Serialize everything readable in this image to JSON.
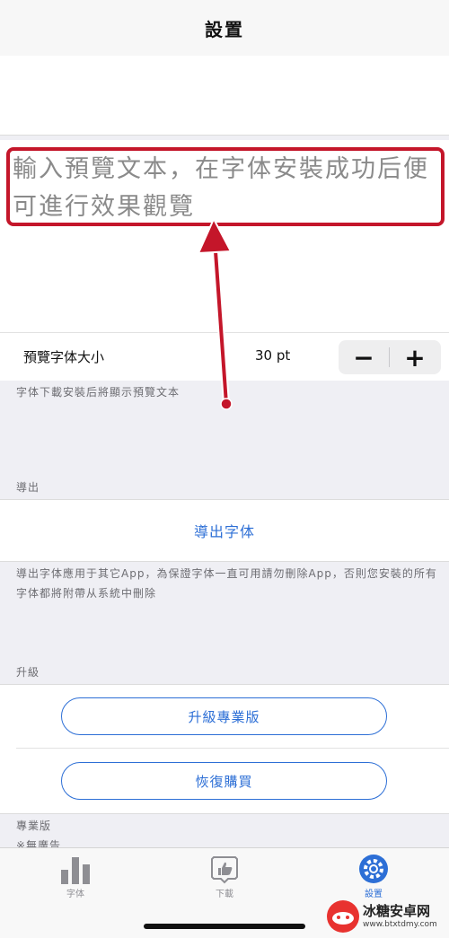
{
  "nav": {
    "title": "設置"
  },
  "preview": {
    "text": "輸入預覽文本，在字体安裝成功后便可進行效果觀覽"
  },
  "font_size": {
    "label": "預覽字体大小",
    "value": "30 pt",
    "minus": "−",
    "plus": "+"
  },
  "notes": {
    "preview_note": "字体下載安裝后將顯示預覽文本",
    "export_header": "導出",
    "export_note": "導出字体應用于其它App，為保證字体一直可用請勿刪除App，否則您安裝的所有字体都將附帶从系統中刪除",
    "upgrade_header": "升級",
    "pro_header": "專業版",
    "pro_item": "※無廣告"
  },
  "export": {
    "button_label": "導出字体"
  },
  "upgrade": {
    "upgrade_label": "升級專業版",
    "restore_label": "恢復購買"
  },
  "tabs": [
    {
      "label": "字体",
      "icon": "bar-chart-icon"
    },
    {
      "label": "下載",
      "icon": "thumbs-up-icon"
    },
    {
      "label": "設置",
      "icon": "gear-icon"
    }
  ],
  "watermark": {
    "title": "冰糖安卓网",
    "url": "www.btxtdmy.com"
  },
  "colors": {
    "accent": "#2d6fd6",
    "highlight": "#c4162a",
    "grouped_bg": "#efeff4"
  }
}
